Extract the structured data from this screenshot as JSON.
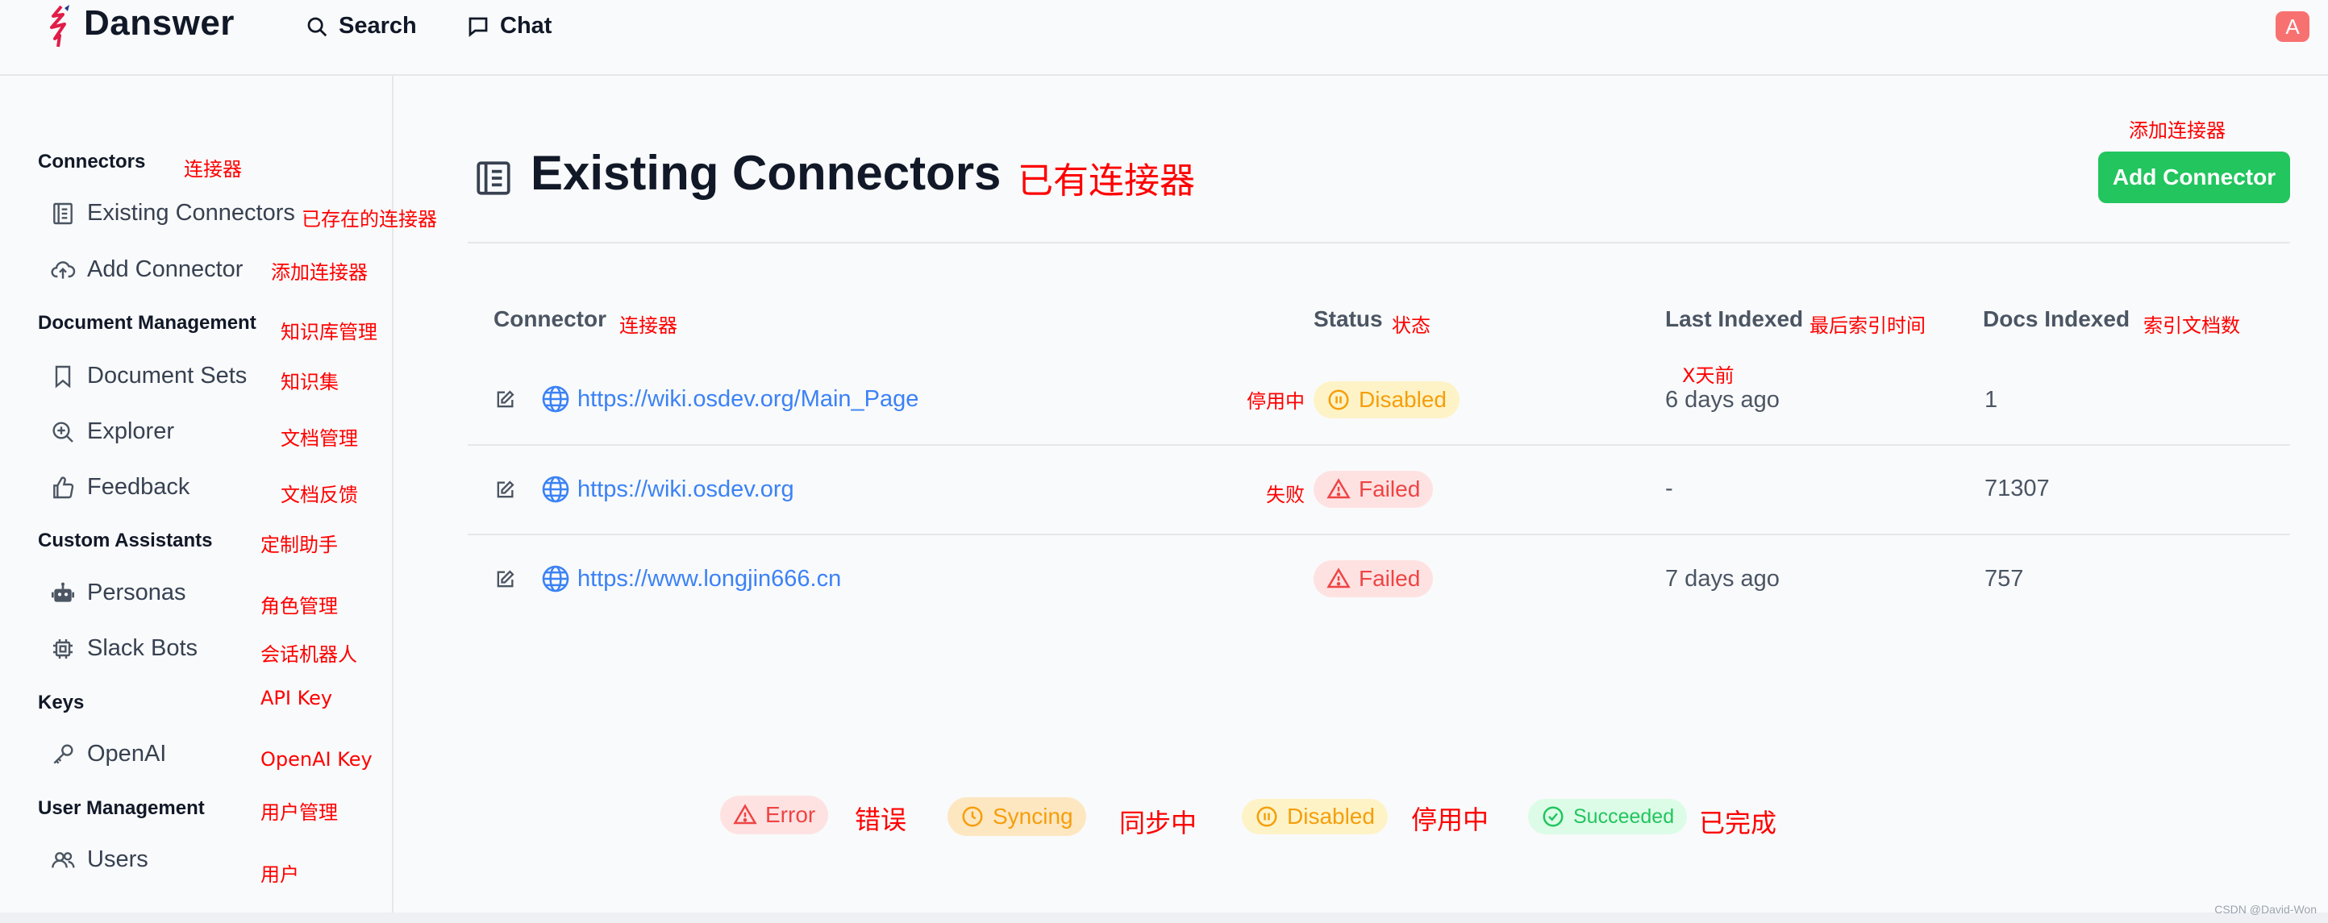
{
  "header": {
    "brand": "Danswer",
    "nav": [
      {
        "label": "Search",
        "icon": "search-icon"
      },
      {
        "label": "Chat",
        "icon": "chat-icon"
      }
    ],
    "avatar_letter": "A"
  },
  "sidebar": {
    "sections": [
      {
        "title": "Connectors",
        "note": "连接器",
        "items": [
          {
            "label": "Existing Connectors",
            "icon": "list-icon",
            "note": "已存在的连接器"
          },
          {
            "label": "Add Connector",
            "icon": "cloud-upload-icon",
            "note": "添加连接器"
          }
        ]
      },
      {
        "title": "Document Management",
        "note": "知识库管理",
        "items": [
          {
            "label": "Document Sets",
            "icon": "bookmark-icon",
            "note": "知识集"
          },
          {
            "label": "Explorer",
            "icon": "zoom-in-icon",
            "note": "文档管理"
          },
          {
            "label": "Feedback",
            "icon": "thumbs-up-icon",
            "note": "文档反馈"
          }
        ]
      },
      {
        "title": "Custom Assistants",
        "note": "定制助手",
        "items": [
          {
            "label": "Personas",
            "icon": "robot-icon",
            "note": "角色管理"
          },
          {
            "label": "Slack Bots",
            "icon": "cpu-icon",
            "note": "会话机器人"
          }
        ]
      },
      {
        "title": "Keys",
        "note": "API Key",
        "items": [
          {
            "label": "OpenAI",
            "icon": "key-icon",
            "note": "OpenAI Key"
          }
        ]
      },
      {
        "title": "User Management",
        "note": "用户管理",
        "items": [
          {
            "label": "Users",
            "icon": "users-icon",
            "note": "用户"
          }
        ]
      }
    ]
  },
  "main": {
    "title": "Existing Connectors",
    "title_note": "已有连接器",
    "add_button": "Add Connector",
    "add_button_note": "添加连接器",
    "columns": [
      {
        "label": "Connector",
        "note": "连接器"
      },
      {
        "label": "Status",
        "note": "状态"
      },
      {
        "label": "Last Indexed",
        "note": "最后索引时间"
      },
      {
        "label": "Docs Indexed",
        "note": "索引文档数"
      }
    ],
    "last_indexed_note": "X天前",
    "rows": [
      {
        "url": "https://wiki.osdev.org/Main_Page",
        "status": "Disabled",
        "status_note": "停用中",
        "last_indexed": "6 days ago",
        "docs": "1"
      },
      {
        "url": "https://wiki.osdev.org",
        "status": "Failed",
        "status_note": "失败",
        "last_indexed": "-",
        "docs": "71307"
      },
      {
        "url": "https://www.longjin666.cn",
        "status": "Failed",
        "status_note": "",
        "last_indexed": "7 days ago",
        "docs": "757"
      }
    ]
  },
  "legend": [
    {
      "label": "Error",
      "note": "错误",
      "color": "#ef4444"
    },
    {
      "label": "Syncing",
      "note": "同步中",
      "color": "#f59e0b"
    },
    {
      "label": "Disabled",
      "note": "停用中",
      "color": "#f59e0b"
    },
    {
      "label": "Succeeded",
      "note": "已完成",
      "color": "#22c55e"
    }
  ],
  "watermark": "CSDN @David-Won",
  "colors": {
    "accent_green": "#22c55e",
    "link_blue": "#3b82f6",
    "annotation_red": "#ff0000"
  }
}
